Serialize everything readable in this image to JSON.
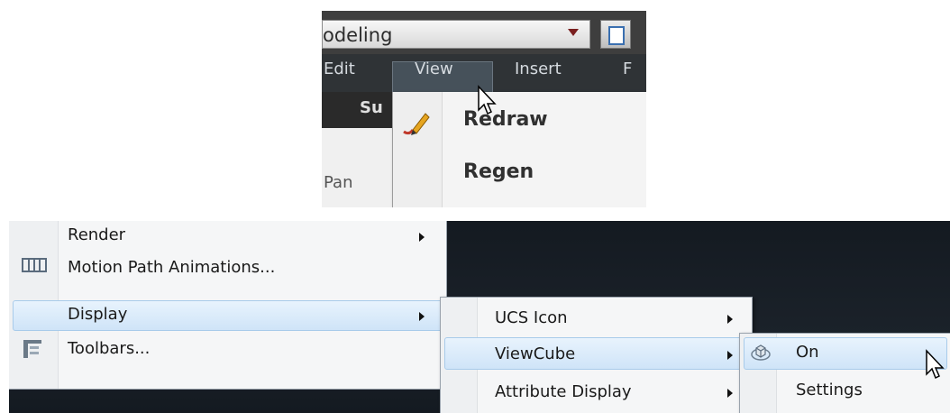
{
  "top_panel": {
    "workspace_value": "odeling",
    "menubar": [
      "Edit",
      "View",
      "Insert",
      "F"
    ],
    "ribbon_tab_partial": "Su",
    "ribbon_button_partial": "Pan",
    "view_menu_items": [
      {
        "label": "Redraw",
        "icon": "pencil-icon"
      },
      {
        "label": "Regen",
        "icon": ""
      }
    ]
  },
  "bottom_panel": {
    "main_menu_items": [
      {
        "label": "Render",
        "has_submenu": true,
        "icon": ""
      },
      {
        "label": "Motion Path Animations...",
        "has_submenu": false,
        "icon": "motion-path-icon"
      },
      {
        "label": "Display",
        "has_submenu": true,
        "icon": "",
        "highlighted": true
      },
      {
        "label": "Toolbars...",
        "has_submenu": false,
        "icon": "toolbars-icon"
      }
    ],
    "display_submenu_items": [
      {
        "label": "UCS Icon",
        "has_submenu": true
      },
      {
        "label": "ViewCube",
        "has_submenu": true,
        "highlighted": true
      },
      {
        "label": "Attribute Display",
        "has_submenu": true
      }
    ],
    "viewcube_submenu_items": [
      {
        "label": "On",
        "icon": "viewcube-icon",
        "highlighted": true
      },
      {
        "label": "Settings",
        "icon": ""
      }
    ]
  },
  "colors": {
    "menubar_bg": "#2f3336",
    "menu_bg": "#f5f6f7",
    "hover_bg": "#cfe4f8",
    "workspace_bg": "#141a21"
  }
}
